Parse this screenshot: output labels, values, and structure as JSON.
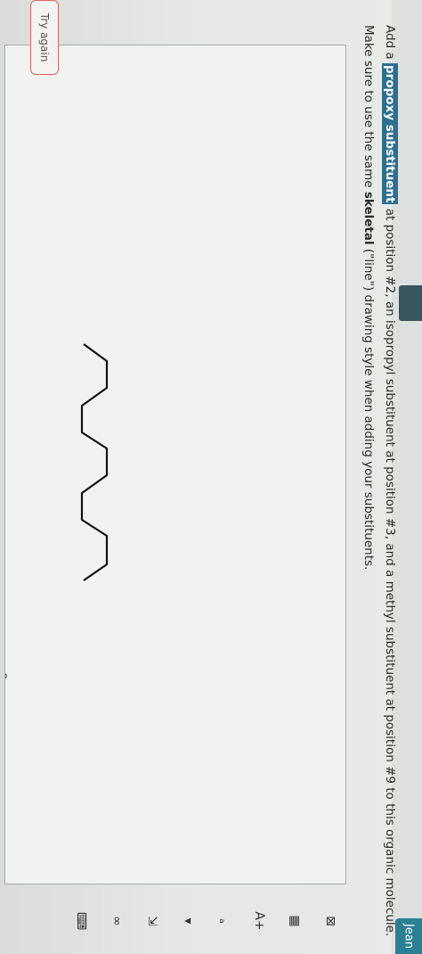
{
  "header": {
    "user_name": "Jean"
  },
  "question": {
    "line1_prefix": "Add a",
    "line1_highlight": "propoxy substituent",
    "line1_rest": " at position #2, an isopropyl substituent at position #3, and a methyl substituent at position #9 to this organic molecule.",
    "line2_prefix": "Make sure to use the same ",
    "line2_bold": "skeletal",
    "line2_rest": " (\"line\") drawing style when adding your substituents."
  },
  "buttons": {
    "try_again": "Try again"
  },
  "molecule": {
    "type": "skeletal-chain",
    "carbon_count": 11
  },
  "toolbar": {
    "icons": [
      "close-x-icon",
      "grid-icon",
      "atom-label-icon",
      "element-table-icon",
      "dropdown-arrow-icon",
      "expand-icon",
      "link-icon",
      "keyboard-icon"
    ],
    "glyphs": [
      "⊠",
      "▦",
      "A+",
      "ₐ",
      "▾",
      "⇲",
      "∞",
      "⌨"
    ]
  },
  "colors": {
    "highlight": "#2d6f8f",
    "try_again_border": "#d8675a",
    "profile": "#2b7f93"
  }
}
